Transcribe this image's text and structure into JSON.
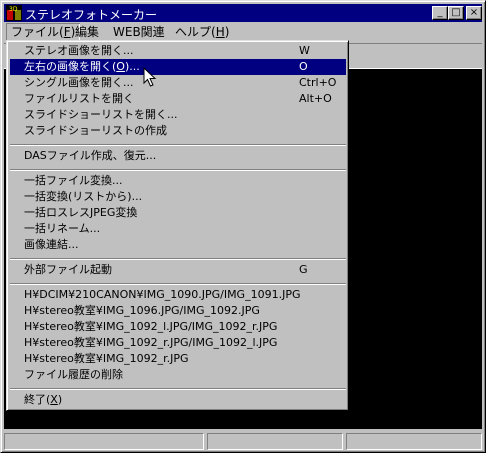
{
  "window": {
    "title": "ステレオフォトメーカー"
  },
  "icons": {
    "app": "stereophoto-app-icon",
    "minimize": "minimize-icon",
    "maximize": "maximize-icon",
    "close": "close-icon",
    "cursor": "mouse-pointer-icon"
  },
  "titlebar_buttons": {
    "minimize": "_",
    "maximize": "□",
    "close": "×"
  },
  "colors": {
    "titlebar": "#000080",
    "highlight": "#000080",
    "face": "#c0c0c0",
    "canvas": "#000000"
  },
  "menubar": {
    "file": {
      "text": "ファイル(",
      "key": "F",
      "end": ")"
    },
    "edit": "編集",
    "web": "WEB関連",
    "help": {
      "text": "ヘルプ(",
      "key": "H",
      "end": ")"
    }
  },
  "file_menu": {
    "open_stereo": {
      "label": "ステレオ画像を開く...",
      "accel": "W"
    },
    "open_lr": {
      "label": "左右の画像を開く(",
      "key": "O",
      "end": ")...",
      "accel": "O"
    },
    "open_single": {
      "label": "シングル画像を開く...",
      "accel": "Ctrl+O"
    },
    "open_filelist": {
      "label": "ファイルリストを開く",
      "accel": "Alt+O"
    },
    "open_slideshow": {
      "label": "スライドショーリストを開く..."
    },
    "create_slideshow": {
      "label": "スライドショーリストの作成"
    },
    "das_file": {
      "label": "DASファイル作成、復元..."
    },
    "batch_convert": {
      "label": "一括ファイル変換..."
    },
    "batch_convert_list": {
      "label": "一括変換(リストから)..."
    },
    "batch_lossless_jpeg": {
      "label": "一括ロスレスJPEG変換"
    },
    "batch_rename": {
      "label": "一括リネーム..."
    },
    "image_join": {
      "label": "画像連結..."
    },
    "external_launch": {
      "label": "外部ファイル起動",
      "accel": "G"
    },
    "recent_files": [
      "H¥DCIM¥210CANON¥IMG_1090.JPG/IMG_1091.JPG",
      "H¥stereo教室¥IMG_1096.JPG/IMG_1092.JPG",
      "H¥stereo教室¥IMG_1092_l.JPG/IMG_1092_r.JPG",
      "H¥stereo教室¥IMG_1092_r.JPG/IMG_1092_l.JPG",
      "H¥stereo教室¥IMG_1092_r.JPG"
    ],
    "clear_history": {
      "label": "ファイル履歴の削除"
    },
    "exit": {
      "label": "終了(",
      "key": "X",
      "end": ")"
    }
  }
}
